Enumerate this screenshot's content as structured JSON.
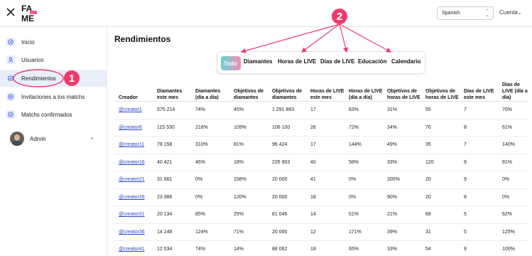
{
  "header": {
    "language": "Spanish",
    "account_label": "Cuenta"
  },
  "sidebar": {
    "items": [
      {
        "label": "Inicio",
        "icon": "compass-icon"
      },
      {
        "label": "Usuarios",
        "icon": "user-icon"
      },
      {
        "label": "Rendimientos",
        "icon": "chart-icon"
      },
      {
        "label": "Invitaciones a los matchs",
        "icon": "invite-icon"
      },
      {
        "label": "Matchs confirmados",
        "icon": "confirmed-icon"
      }
    ],
    "active_index": 2,
    "user_label": "Admin"
  },
  "main": {
    "title": "Rendimientos",
    "tabs": [
      "Todo",
      "Diamantes",
      "Horas de LIVE",
      "Días de LIVE",
      "Educación",
      "Calendario"
    ],
    "active_tab": 0,
    "table": {
      "headers": [
        "Creador",
        "Diamantes este mes",
        "Diamantes (día a día)",
        "Objetivos de diamantes",
        "Objetivos de diamantes",
        "Horas de LIVE este mes",
        "Horas de LIVE (día a día)",
        "Objetivos de horas de LIVE",
        "Objetivos de horas de LIVE",
        "Días de LIVE este mes",
        "Días de LIVE (día a día)"
      ],
      "rows": [
        [
          "@creator1",
          "575 214",
          "74%",
          "45%",
          "1 291 883",
          "17",
          "63%",
          "31%",
          "55",
          "7",
          "70%"
        ],
        [
          "@creator6",
          "115 530",
          "218%",
          "109%",
          "106 100",
          "26",
          "72%",
          "34%",
          "76",
          "8",
          "61%"
        ],
        [
          "@creator11",
          "78 158",
          "310%",
          "81%",
          "96 424",
          "17",
          "144%",
          "49%",
          "35",
          "7",
          "140%"
        ],
        [
          "@creator16",
          "40 421",
          "46%",
          "18%",
          "226 903",
          "40",
          "58%",
          "33%",
          "120",
          "9",
          "81%"
        ],
        [
          "@creator21",
          "31 681",
          "0%",
          "158%",
          "20 000",
          "41",
          "0%",
          "205%",
          "20",
          "9",
          "0%"
        ],
        [
          "@creator26",
          "23 986",
          "0%",
          "120%",
          "20 000",
          "18",
          "0%",
          "90%",
          "20",
          "8",
          "0%"
        ],
        [
          "@creator31",
          "20 134",
          "85%",
          "25%",
          "81 046",
          "14",
          "51%",
          "21%",
          "68",
          "5",
          "62%"
        ],
        [
          "@creator36",
          "14 248",
          "124%",
          "71%",
          "20 000",
          "12",
          "171%",
          "39%",
          "31",
          "5",
          "125%"
        ],
        [
          "@creator41",
          "12 034",
          "74%",
          "14%",
          "88 062",
          "18",
          "65%",
          "33%",
          "54",
          "9",
          "100%"
        ]
      ]
    }
  },
  "annotations": {
    "badge_1": "1",
    "badge_2": "2",
    "color": "#ee3a6b"
  }
}
